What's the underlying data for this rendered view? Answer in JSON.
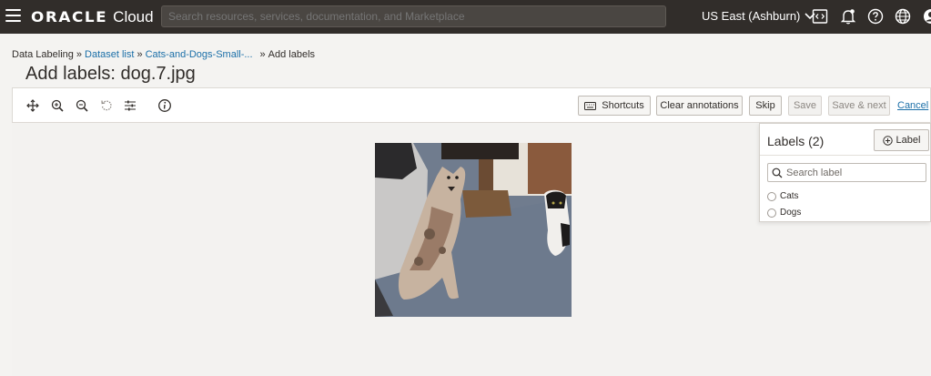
{
  "topbar": {
    "brand_primary": "ORACLE",
    "brand_secondary": "Cloud",
    "search_placeholder": "Search resources, services, documentation, and Marketplace",
    "region": "US East (Ashburn)"
  },
  "breadcrumb": {
    "root": "Data Labeling",
    "dataset_list": "Dataset list",
    "dataset": "Cats-and-Dogs-Small-...",
    "current": "Add labels",
    "separator": "»"
  },
  "page": {
    "title": "Add labels: dog.7.jpg"
  },
  "toolbar": {
    "shortcuts": "Shortcuts",
    "clear": "Clear annotations",
    "skip": "Skip",
    "save": "Save",
    "save_next": "Save & next",
    "cancel": "Cancel"
  },
  "labels_panel": {
    "title": "Labels (2)",
    "add_label": "Label",
    "search_placeholder": "Search label",
    "options": [
      "Cats",
      "Dogs"
    ]
  },
  "colors": {
    "topbar": "#312d2a",
    "link": "#1b6fa8",
    "page_bg": "#f4f3f1"
  }
}
